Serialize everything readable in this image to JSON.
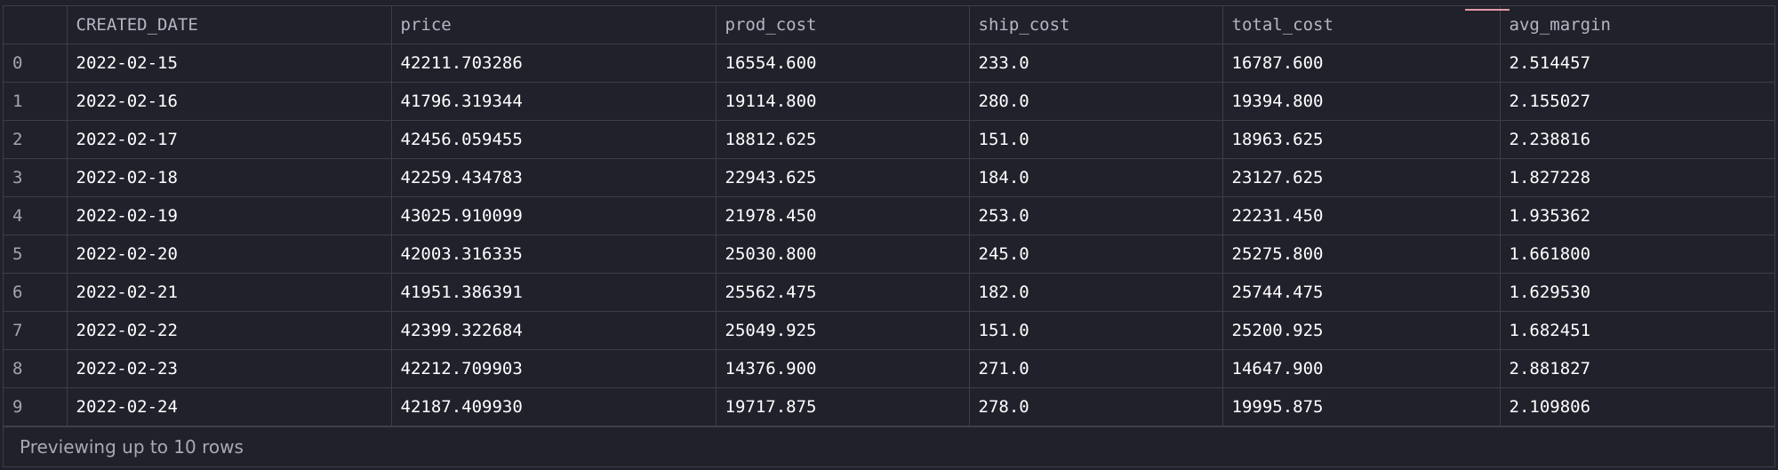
{
  "table": {
    "index_header": "",
    "columns": [
      "CREATED_DATE",
      "price",
      "prod_cost",
      "ship_cost",
      "total_cost",
      "avg_margin"
    ],
    "rows": [
      {
        "index": "0",
        "cells": [
          "2022-02-15",
          "42211.703286",
          "16554.600",
          "233.0",
          "16787.600",
          "2.514457"
        ]
      },
      {
        "index": "1",
        "cells": [
          "2022-02-16",
          "41796.319344",
          "19114.800",
          "280.0",
          "19394.800",
          "2.155027"
        ]
      },
      {
        "index": "2",
        "cells": [
          "2022-02-17",
          "42456.059455",
          "18812.625",
          "151.0",
          "18963.625",
          "2.238816"
        ]
      },
      {
        "index": "3",
        "cells": [
          "2022-02-18",
          "42259.434783",
          "22943.625",
          "184.0",
          "23127.625",
          "1.827228"
        ]
      },
      {
        "index": "4",
        "cells": [
          "2022-02-19",
          "43025.910099",
          "21978.450",
          "253.0",
          "22231.450",
          "1.935362"
        ]
      },
      {
        "index": "5",
        "cells": [
          "2022-02-20",
          "42003.316335",
          "25030.800",
          "245.0",
          "25275.800",
          "1.661800"
        ]
      },
      {
        "index": "6",
        "cells": [
          "2022-02-21",
          "41951.386391",
          "25562.475",
          "182.0",
          "25744.475",
          "1.629530"
        ]
      },
      {
        "index": "7",
        "cells": [
          "2022-02-22",
          "42399.322684",
          "25049.925",
          "151.0",
          "25200.925",
          "1.682451"
        ]
      },
      {
        "index": "8",
        "cells": [
          "2022-02-23",
          "42212.709903",
          "14376.900",
          "271.0",
          "14647.900",
          "2.881827"
        ]
      },
      {
        "index": "9",
        "cells": [
          "2022-02-24",
          "42187.409930",
          "19717.875",
          "278.0",
          "19995.875",
          "2.109806"
        ]
      }
    ]
  },
  "footer": {
    "preview_text": "Previewing up to 10 rows"
  },
  "colors": {
    "background": "#20212b",
    "grid_line": "#3c3e4a",
    "header_text": "#b3b6c3",
    "cell_text": "#ffffff",
    "index_text": "#a2a5b2",
    "accent": "#e39aa6"
  }
}
